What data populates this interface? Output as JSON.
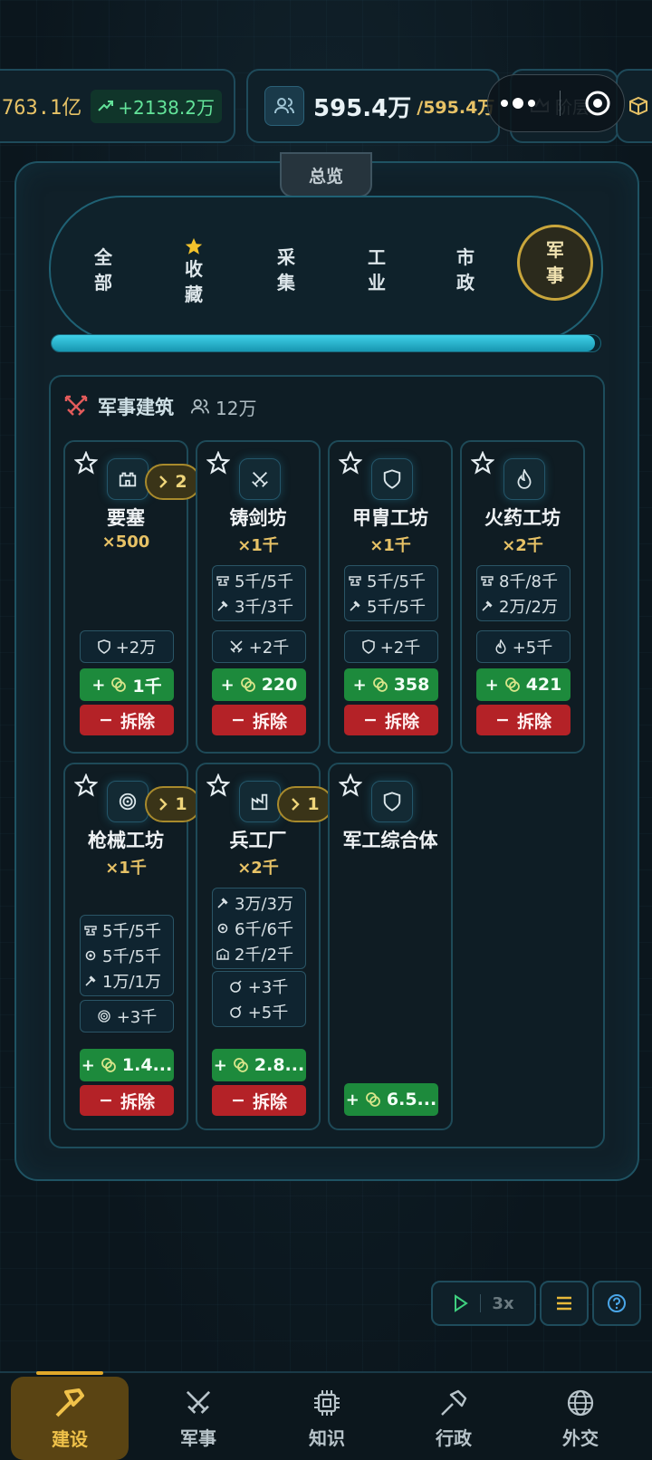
{
  "resources": {
    "money_value": "763.1亿",
    "money_growth": "+2138.2万",
    "population_value": "595.4万",
    "population_cap": "/595.4万",
    "stage_label": "阶层"
  },
  "panel": {
    "tab_label": "总览",
    "categories": [
      {
        "label_1": "全",
        "label_2": "部"
      },
      {
        "label_1": "收",
        "label_2": "藏"
      },
      {
        "label_1": "采",
        "label_2": "集"
      },
      {
        "label_1": "工",
        "label_2": "业"
      },
      {
        "label_1": "市",
        "label_2": "政"
      },
      {
        "label_1": "军",
        "label_2": "事"
      }
    ],
    "active_category": "军事",
    "progress_fraction": 0.99
  },
  "section": {
    "title": "军事建筑",
    "population": "12万"
  },
  "buildings": [
    {
      "name": "要塞",
      "count": "×500",
      "level": "2",
      "requirements": [],
      "production": [
        "+2万"
      ],
      "cost": "1千",
      "demolish": "拆除"
    },
    {
      "name": "铸剑坊",
      "count": "×1千",
      "level": "",
      "requirements": [
        "5千/5千",
        "3千/3千"
      ],
      "production": [
        "+2千"
      ],
      "cost": "220",
      "demolish": "拆除"
    },
    {
      "name": "甲胄工坊",
      "count": "×1千",
      "level": "",
      "requirements": [
        "5千/5千",
        "5千/5千"
      ],
      "production": [
        "+2千"
      ],
      "cost": "358",
      "demolish": "拆除"
    },
    {
      "name": "火药工坊",
      "count": "×2千",
      "level": "",
      "requirements": [
        "8千/8千",
        "2万/2万"
      ],
      "production": [
        "+5千"
      ],
      "cost": "421",
      "demolish": "拆除"
    },
    {
      "name": "枪械工坊",
      "count": "×1千",
      "level": "1",
      "requirements": [
        "5千/5千",
        "5千/5千",
        "1万/1万"
      ],
      "production": [
        "+3千"
      ],
      "cost": "1.4...",
      "demolish": "拆除"
    },
    {
      "name": "兵工厂",
      "count": "×2千",
      "level": "1",
      "requirements": [
        "3万/3万",
        "6千/6千",
        "2千/2千"
      ],
      "production": [
        "+3千",
        "+5千"
      ],
      "cost": "2.8...",
      "demolish": "拆除"
    },
    {
      "name": "军工综合体",
      "count": "",
      "level": "",
      "requirements": [],
      "production": [],
      "cost": "6.5...",
      "demolish": ""
    }
  ],
  "controls": {
    "speed": "3x"
  },
  "nav": [
    {
      "label": "建设",
      "icon": "hammer-icon"
    },
    {
      "label": "军事",
      "icon": "crossed-swords-icon"
    },
    {
      "label": "知识",
      "icon": "chip-icon"
    },
    {
      "label": "行政",
      "icon": "gavel-icon"
    },
    {
      "label": "外交",
      "icon": "globe-icon"
    }
  ],
  "colors": {
    "accent_gold": "#e7c266",
    "build_green": "#1d8a3c",
    "demolish_red": "#b42227",
    "progress_cyan": "#3fd0e8"
  }
}
